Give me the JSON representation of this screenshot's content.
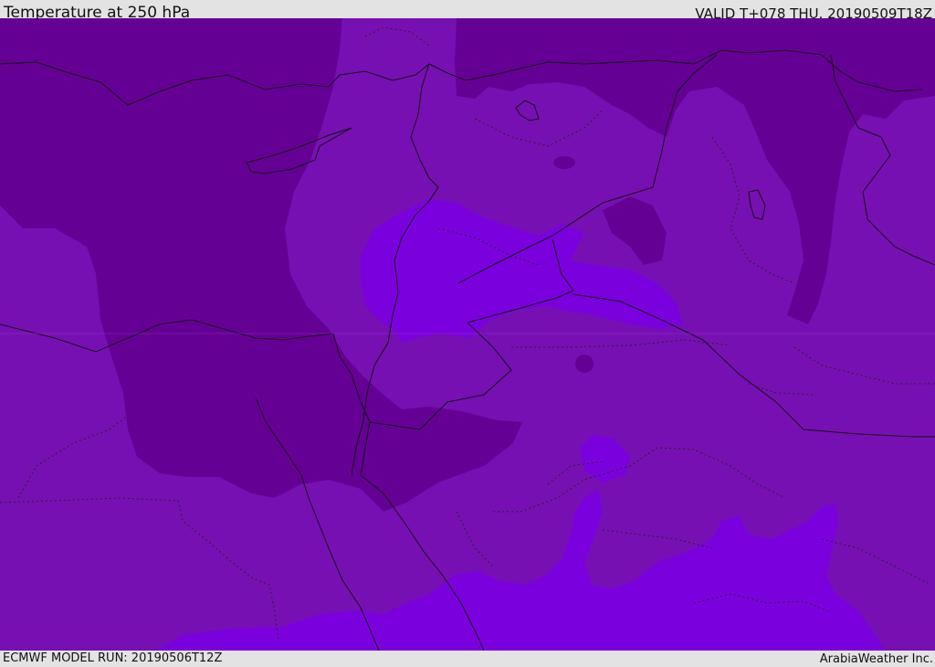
{
  "header": {
    "title": "Temperature at 250 hPa",
    "valid": "VALID T+078 THU. 20190509T18Z"
  },
  "footer": {
    "model_run": "ECMWF MODEL RUN: 20190506T12Z",
    "credit": "ArabiaWeather Inc."
  },
  "colors": {
    "coldest": "#650094",
    "mid": "#7710b3",
    "warm": "#7b00de",
    "border": "#111111"
  }
}
